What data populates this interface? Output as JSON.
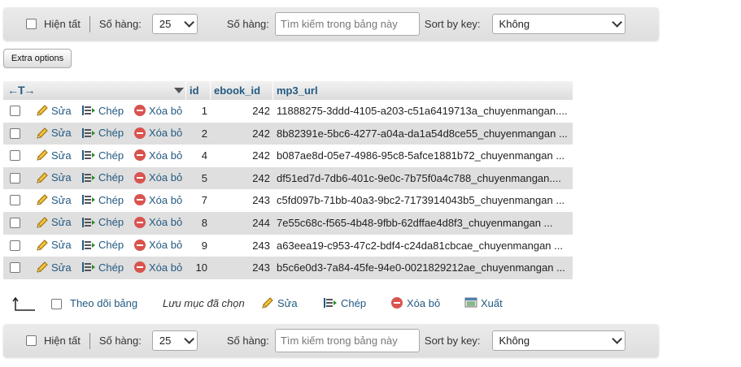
{
  "nav": {
    "show_all": "Hiện tất",
    "rows_label": "Số hàng:",
    "rows_value": "25",
    "search_label": "Số hàng:",
    "search_placeholder": "Tìm kiếm trong bảng này",
    "sort_label": "Sort by key:",
    "sort_value": "Không"
  },
  "extra_options": "Extra options",
  "table": {
    "arrows": "←T→",
    "columns": [
      "id",
      "ebook_id",
      "mp3_url"
    ],
    "actions": {
      "edit": "Sửa",
      "copy": "Chép",
      "delete": "Xóa bỏ"
    },
    "rows": [
      {
        "id": "1",
        "ebook_id": "242",
        "mp3_url": "11888275-3ddd-4105-a203-c51a6419713a_chuyenmangan...."
      },
      {
        "id": "2",
        "ebook_id": "242",
        "mp3_url": "8b82391e-5bc6-4277-a04a-da1a54d8ce55_chuyenmangan ..."
      },
      {
        "id": "4",
        "ebook_id": "242",
        "mp3_url": "b087ae8d-05e7-4986-95c8-5afce1881b72_chuyenmangan ..."
      },
      {
        "id": "5",
        "ebook_id": "242",
        "mp3_url": "df51ed7d-7db6-401c-9e0c-7b75f0a4c788_chuyenmangan...."
      },
      {
        "id": "7",
        "ebook_id": "243",
        "mp3_url": "c5fd097b-71bb-40a3-9bc2-7173914043b5_chuyenmangan ..."
      },
      {
        "id": "8",
        "ebook_id": "244",
        "mp3_url": "7e55c68c-f565-4b48-9fbb-62dffae4d8f3_chuyenmangan ..."
      },
      {
        "id": "9",
        "ebook_id": "243",
        "mp3_url": "a63eea19-c953-47c2-bdf4-c24da81cbcae_chuyenmangan ..."
      },
      {
        "id": "10",
        "ebook_id": "243",
        "mp3_url": "b5c6e0d3-7a84-45fe-94e0-0021829212ae_chuyenmangan ..."
      }
    ]
  },
  "bulk": {
    "check_all": "Theo dõi bảng",
    "with_selected": "Lưu mục đã chọn",
    "edit": "Sửa",
    "copy": "Chép",
    "delete": "Xóa bỏ",
    "export": "Xuất"
  },
  "colors": {
    "link": "#235a81",
    "row_alt": "#dfdfdf",
    "delete": "#d9534f"
  }
}
